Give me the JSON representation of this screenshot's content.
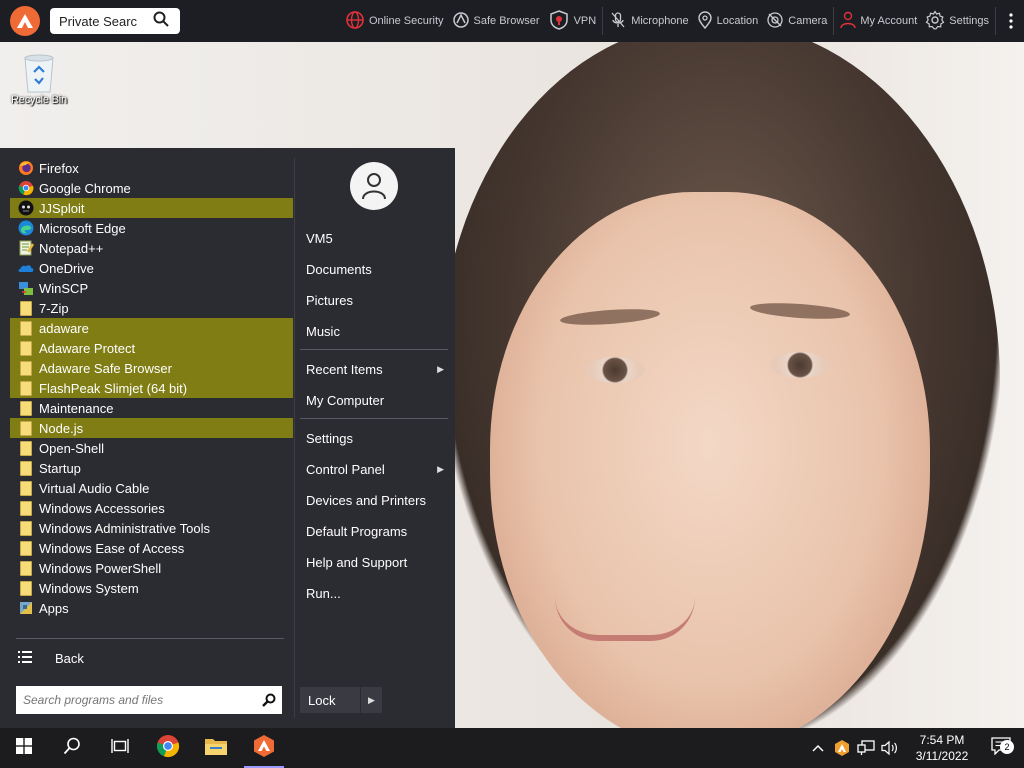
{
  "toolbar": {
    "search_value": "Private Searc",
    "tools": [
      {
        "label": "Online Security",
        "icon": "globe-shield-icon"
      },
      {
        "label": "Safe Browser",
        "icon": "safe-browser-icon"
      },
      {
        "label": "VPN",
        "icon": "vpn-shield-icon"
      },
      {
        "label": "Microphone",
        "icon": "microphone-off-icon"
      },
      {
        "label": "Location",
        "icon": "location-pin-icon"
      },
      {
        "label": "Camera",
        "icon": "camera-off-icon"
      },
      {
        "label": "My Account",
        "icon": "user-icon"
      },
      {
        "label": "Settings",
        "icon": "gear-icon"
      }
    ],
    "accent": "#f06a35",
    "bg": "#1d1e24"
  },
  "desktop": {
    "icons": [
      {
        "label": "Recycle Bin",
        "icon": "recycle-bin-icon"
      }
    ]
  },
  "start_menu": {
    "programs": [
      {
        "label": "Firefox",
        "icon": "firefox-icon",
        "highlighted": false
      },
      {
        "label": "Google Chrome",
        "icon": "chrome-icon",
        "highlighted": false
      },
      {
        "label": "JJSploit",
        "icon": "jjsploit-icon",
        "highlighted": true
      },
      {
        "label": "Microsoft Edge",
        "icon": "edge-icon",
        "highlighted": false
      },
      {
        "label": "Notepad++",
        "icon": "notepadpp-icon",
        "highlighted": false
      },
      {
        "label": "OneDrive",
        "icon": "onedrive-icon",
        "highlighted": false
      },
      {
        "label": "WinSCP",
        "icon": "winscp-icon",
        "highlighted": false
      },
      {
        "label": "7-Zip",
        "icon": "folder-icon",
        "highlighted": false
      },
      {
        "label": "adaware",
        "icon": "folder-icon",
        "highlighted": true
      },
      {
        "label": "Adaware Protect",
        "icon": "folder-icon",
        "highlighted": true
      },
      {
        "label": "Adaware Safe Browser",
        "icon": "folder-icon",
        "highlighted": true
      },
      {
        "label": "FlashPeak Slimjet (64 bit)",
        "icon": "folder-icon",
        "highlighted": true
      },
      {
        "label": "Maintenance",
        "icon": "folder-icon",
        "highlighted": false
      },
      {
        "label": "Node.js",
        "icon": "folder-icon",
        "highlighted": true
      },
      {
        "label": "Open-Shell",
        "icon": "folder-icon",
        "highlighted": false
      },
      {
        "label": "Startup",
        "icon": "folder-icon",
        "highlighted": false
      },
      {
        "label": "Virtual Audio Cable",
        "icon": "folder-icon",
        "highlighted": false
      },
      {
        "label": "Windows Accessories",
        "icon": "folder-icon",
        "highlighted": false
      },
      {
        "label": "Windows Administrative Tools",
        "icon": "folder-icon",
        "highlighted": false
      },
      {
        "label": "Windows Ease of Access",
        "icon": "folder-icon",
        "highlighted": false
      },
      {
        "label": "Windows PowerShell",
        "icon": "folder-icon",
        "highlighted": false
      },
      {
        "label": "Windows System",
        "icon": "folder-icon",
        "highlighted": false
      },
      {
        "label": "Apps",
        "icon": "apps-icon",
        "highlighted": false
      }
    ],
    "back_label": "Back",
    "search_placeholder": "Search programs and files",
    "right_items": [
      {
        "label": "VM5",
        "submenu": false
      },
      {
        "label": "Documents",
        "submenu": false
      },
      {
        "label": "Pictures",
        "submenu": false
      },
      {
        "label": "Music",
        "submenu": false
      },
      {
        "label": "Recent Items",
        "submenu": true
      },
      {
        "label": "My Computer",
        "submenu": false
      },
      {
        "label": "Settings",
        "submenu": false
      },
      {
        "label": "Control Panel",
        "submenu": true
      },
      {
        "label": "Devices and Printers",
        "submenu": false
      },
      {
        "label": "Default Programs",
        "submenu": false
      },
      {
        "label": "Help and Support",
        "submenu": false
      },
      {
        "label": "Run...",
        "submenu": false
      }
    ],
    "lock_label": "Lock",
    "highlight_color": "#7f7d14",
    "bg": "#2b2b32"
  },
  "taskbar": {
    "buttons": [
      {
        "name": "start-button",
        "icon": "windows-logo-icon",
        "active": false
      },
      {
        "name": "search-button",
        "icon": "search-icon",
        "active": false
      },
      {
        "name": "task-view-button",
        "icon": "task-view-icon",
        "active": false
      },
      {
        "name": "chrome-taskbar-button",
        "icon": "chrome-icon",
        "active": false
      },
      {
        "name": "file-explorer-button",
        "icon": "folder-icon",
        "active": false
      },
      {
        "name": "adaware-taskbar-button",
        "icon": "adaware-icon",
        "active": true
      }
    ],
    "clock_time": "7:54 PM",
    "clock_date": "3/11/2022",
    "notification_count": "2"
  }
}
